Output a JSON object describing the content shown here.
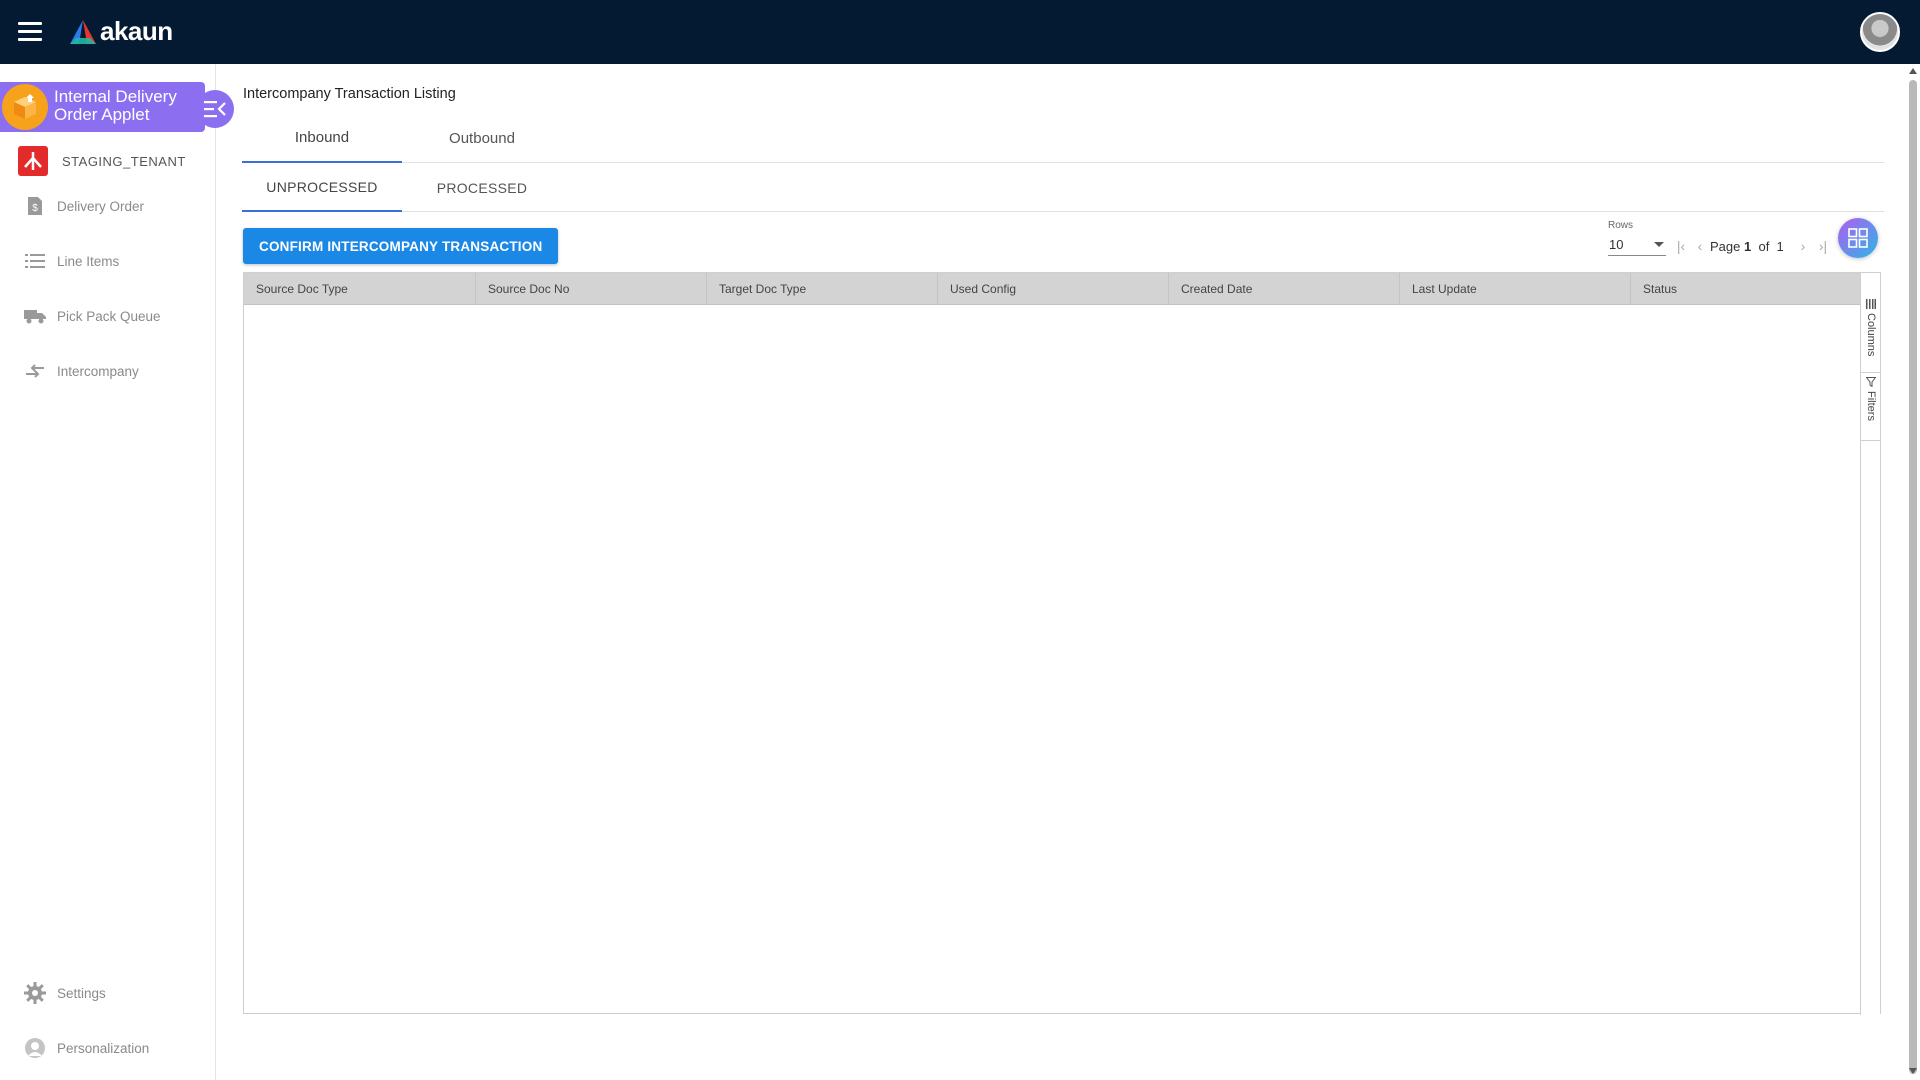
{
  "app": {
    "brand": "akaun"
  },
  "sidebar": {
    "applet_title": "Internal Delivery Order Applet",
    "tenant": "STAGING_TENANT",
    "items": [
      {
        "label": "Delivery Order",
        "icon": "document-dollar-icon"
      },
      {
        "label": "Line Items",
        "icon": "list-icon"
      },
      {
        "label": "Pick Pack Queue",
        "icon": "truck-icon"
      },
      {
        "label": "Intercompany",
        "icon": "transfer-arrows-icon"
      }
    ],
    "bottom_items": [
      {
        "label": "Settings",
        "icon": "gear-icon"
      },
      {
        "label": "Personalization",
        "icon": "person-icon"
      }
    ]
  },
  "main": {
    "title": "Intercompany Transaction Listing",
    "tabs": [
      {
        "label": "Inbound",
        "active": true
      },
      {
        "label": "Outbound",
        "active": false
      }
    ],
    "subtabs": [
      {
        "label": "UNPROCESSED",
        "active": true
      },
      {
        "label": "PROCESSED",
        "active": false
      }
    ],
    "confirm_button": "CONFIRM INTERCOMPANY TRANSACTION",
    "pager": {
      "rows_label": "Rows",
      "rows_value": "10",
      "page_label": "Page",
      "page": "1",
      "of_label": "of",
      "total_pages": "1"
    },
    "table": {
      "columns": [
        "Source Doc Type",
        "Source Doc No",
        "Target Doc Type",
        "Used Config",
        "Created Date",
        "Last Update",
        "Status"
      ],
      "rows": []
    },
    "side_tabs": {
      "columns": "Columns",
      "filters": "Filters"
    }
  },
  "colors": {
    "topbar": "#041a33",
    "applet": "#8b6ff0",
    "primary_button": "#1c88e5",
    "active_tab": "#3a6fd8"
  }
}
